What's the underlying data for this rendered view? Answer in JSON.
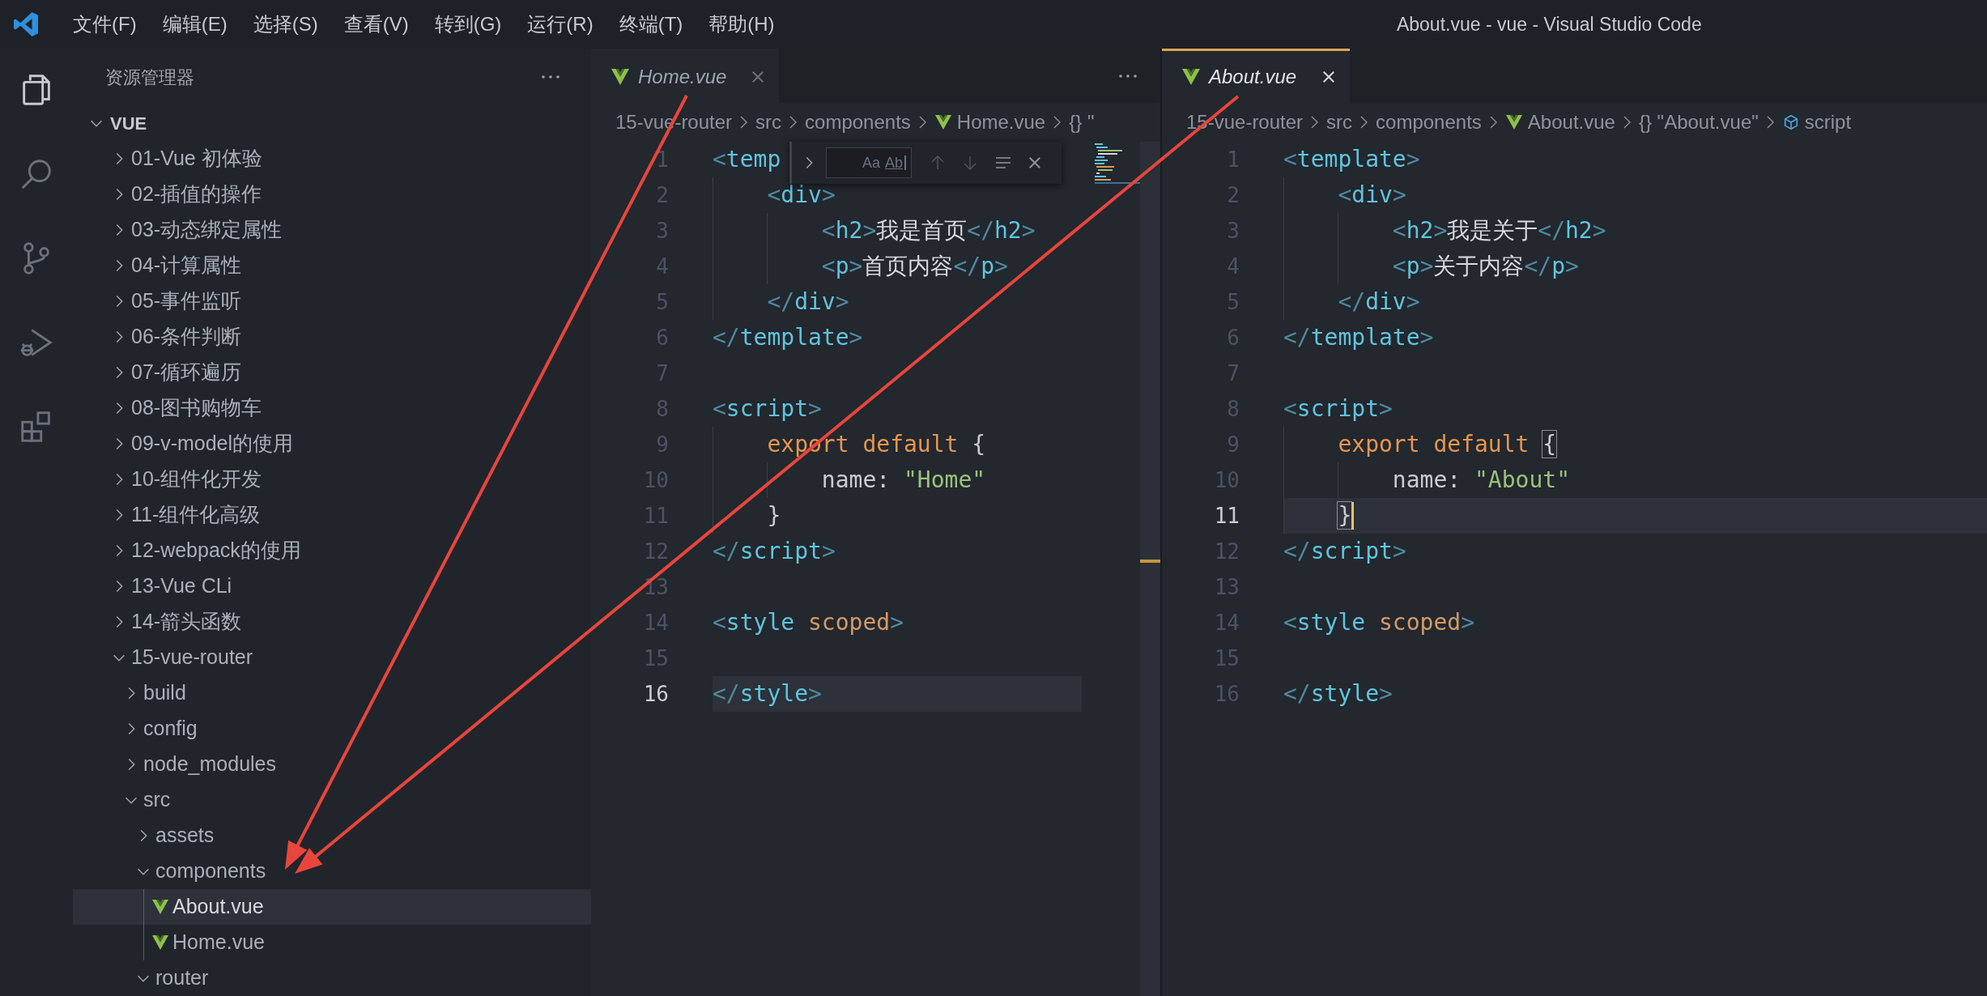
{
  "title_bar": {
    "menus": [
      "文件(F)",
      "编辑(E)",
      "选择(S)",
      "查看(V)",
      "转到(G)",
      "运行(R)",
      "终端(T)",
      "帮助(H)"
    ],
    "title": "About.vue - vue - Visual Studio Code"
  },
  "activity_bar": [
    {
      "kind": "explorer",
      "selected": true
    },
    {
      "kind": "search",
      "selected": false
    },
    {
      "kind": "source-control",
      "selected": false
    },
    {
      "kind": "run-debug",
      "selected": false
    },
    {
      "kind": "extensions",
      "selected": false
    }
  ],
  "explorer": {
    "title": "资源管理器",
    "root": {
      "label": "VUE",
      "expanded": true,
      "children": [
        {
          "kind": "folder",
          "label": "01-Vue 初体验",
          "expanded": false,
          "selected": false
        },
        {
          "kind": "folder",
          "label": "02-插值的操作",
          "expanded": false,
          "selected": false
        },
        {
          "kind": "folder",
          "label": "03-动态绑定属性",
          "expanded": false,
          "selected": false
        },
        {
          "kind": "folder",
          "label": "04-计算属性",
          "expanded": false,
          "selected": false
        },
        {
          "kind": "folder",
          "label": "05-事件监听",
          "expanded": false,
          "selected": false
        },
        {
          "kind": "folder",
          "label": "06-条件判断",
          "expanded": false,
          "selected": false
        },
        {
          "kind": "folder",
          "label": "07-循环遍历",
          "expanded": false,
          "selected": false
        },
        {
          "kind": "folder",
          "label": "08-图书购物车",
          "expanded": false,
          "selected": false
        },
        {
          "kind": "folder",
          "label": "09-v-model的使用",
          "expanded": false,
          "selected": false
        },
        {
          "kind": "folder",
          "label": "10-组件化开发",
          "expanded": false,
          "selected": false
        },
        {
          "kind": "folder",
          "label": "11-组件化高级",
          "expanded": false,
          "selected": false
        },
        {
          "kind": "folder",
          "label": "12-webpack的使用",
          "expanded": false,
          "selected": false
        },
        {
          "kind": "folder",
          "label": "13-Vue CLi",
          "expanded": false,
          "selected": false
        },
        {
          "kind": "folder",
          "label": "14-箭头函数",
          "expanded": false,
          "selected": false
        },
        {
          "kind": "folder",
          "label": "15-vue-router",
          "expanded": true,
          "selected": false,
          "children": [
            {
              "kind": "folder",
              "label": "build",
              "expanded": false,
              "selected": false
            },
            {
              "kind": "folder",
              "label": "config",
              "expanded": false,
              "selected": false
            },
            {
              "kind": "folder",
              "label": "node_modules",
              "expanded": false,
              "selected": false
            },
            {
              "kind": "folder",
              "label": "src",
              "expanded": true,
              "selected": false,
              "children": [
                {
                  "kind": "folder",
                  "label": "assets",
                  "expanded": false,
                  "selected": false
                },
                {
                  "kind": "folder",
                  "label": "components",
                  "expanded": true,
                  "selected": false,
                  "children": [
                    {
                      "kind": "vue-file",
                      "label": "About.vue",
                      "selected": true
                    },
                    {
                      "kind": "vue-file",
                      "label": "Home.vue",
                      "selected": false
                    }
                  ]
                },
                {
                  "kind": "folder",
                  "label": "router",
                  "expanded": true,
                  "selected": false
                }
              ]
            }
          ]
        }
      ]
    }
  },
  "editors": [
    {
      "focused": false,
      "minimap": true,
      "tab": {
        "label": "Home.vue",
        "preview": true
      },
      "breadcrumbs": [
        {
          "kind": "folder",
          "text": "15-vue-router"
        },
        {
          "kind": "folder",
          "text": "src"
        },
        {
          "kind": "folder",
          "text": "components"
        },
        {
          "kind": "vue-file",
          "text": "Home.vue"
        },
        {
          "kind": "object",
          "text": "{} \""
        }
      ],
      "find_widget": {
        "match_case": "Aa",
        "whole_word": "Ab"
      },
      "lines": [
        {
          "number": "1",
          "current": false,
          "tokens": [
            {
              "kind": "bracket",
              "text": "<"
            },
            {
              "kind": "tag",
              "text": "temp"
            }
          ]
        },
        {
          "number": "2",
          "current": false,
          "tokens": [
            {
              "kind": "bracket",
              "text": "    <"
            },
            {
              "kind": "tag",
              "text": "div"
            },
            {
              "kind": "bracket",
              "text": ">"
            }
          ]
        },
        {
          "number": "3",
          "current": false,
          "tokens": [
            {
              "kind": "bracket",
              "text": "        <"
            },
            {
              "kind": "tag",
              "text": "h2"
            },
            {
              "kind": "bracket",
              "text": ">"
            },
            {
              "kind": "text",
              "text": "我是首页"
            },
            {
              "kind": "bracket",
              "text": "</"
            },
            {
              "kind": "tag",
              "text": "h2"
            },
            {
              "kind": "bracket",
              "text": ">"
            }
          ]
        },
        {
          "number": "4",
          "current": false,
          "tokens": [
            {
              "kind": "bracket",
              "text": "        <"
            },
            {
              "kind": "tag",
              "text": "p"
            },
            {
              "kind": "bracket",
              "text": ">"
            },
            {
              "kind": "text",
              "text": "首页内容"
            },
            {
              "kind": "bracket",
              "text": "</"
            },
            {
              "kind": "tag",
              "text": "p"
            },
            {
              "kind": "bracket",
              "text": ">"
            }
          ]
        },
        {
          "number": "5",
          "current": false,
          "tokens": [
            {
              "kind": "bracket",
              "text": "    </"
            },
            {
              "kind": "tag",
              "text": "div"
            },
            {
              "kind": "bracket",
              "text": ">"
            }
          ]
        },
        {
          "number": "6",
          "current": false,
          "tokens": [
            {
              "kind": "bracket",
              "text": "</"
            },
            {
              "kind": "tag",
              "text": "template"
            },
            {
              "kind": "bracket",
              "text": ">"
            }
          ]
        },
        {
          "number": "7",
          "current": false
        },
        {
          "number": "8",
          "current": false,
          "tokens": [
            {
              "kind": "bracket",
              "text": "<"
            },
            {
              "kind": "tag",
              "text": "script"
            },
            {
              "kind": "bracket",
              "text": ">"
            }
          ]
        },
        {
          "number": "9",
          "current": false,
          "tokens": [
            {
              "kind": "keyword",
              "text": "    export default"
            },
            {
              "kind": "brace",
              "text": " {",
              "matched": false
            }
          ]
        },
        {
          "number": "10",
          "current": false,
          "tokens": [
            {
              "kind": "plain",
              "text": "        name: "
            },
            {
              "kind": "string",
              "text": "\"Home\""
            }
          ]
        },
        {
          "number": "11",
          "current": false,
          "tokens": [
            {
              "kind": "brace",
              "text": "    }",
              "matched": false
            }
          ]
        },
        {
          "number": "12",
          "current": false,
          "tokens": [
            {
              "kind": "bracket",
              "text": "</"
            },
            {
              "kind": "tag",
              "text": "script"
            },
            {
              "kind": "bracket",
              "text": ">"
            }
          ]
        },
        {
          "number": "13",
          "current": false
        },
        {
          "number": "14",
          "current": false,
          "tokens": [
            {
              "kind": "bracket",
              "text": "<"
            },
            {
              "kind": "tag",
              "text": "style"
            },
            {
              "kind": "attr",
              "text": " scoped"
            },
            {
              "kind": "bracket",
              "text": ">"
            }
          ]
        },
        {
          "number": "15",
          "current": false
        },
        {
          "number": "16",
          "current": true,
          "tokens": [
            {
              "kind": "bracket",
              "text": "</"
            },
            {
              "kind": "tag",
              "text": "style"
            },
            {
              "kind": "bracket",
              "text": ">"
            }
          ]
        }
      ]
    },
    {
      "focused": true,
      "tab": {
        "label": "About.vue",
        "preview": true
      },
      "breadcrumbs": [
        {
          "kind": "folder",
          "text": "15-vue-router"
        },
        {
          "kind": "folder",
          "text": "src"
        },
        {
          "kind": "folder",
          "text": "components"
        },
        {
          "kind": "vue-file",
          "text": "About.vue"
        },
        {
          "kind": "object",
          "text": "{} \"About.vue\""
        },
        {
          "kind": "element",
          "text": "script"
        }
      ],
      "lines": [
        {
          "number": "1",
          "current": false,
          "tokens": [
            {
              "kind": "bracket",
              "text": "<"
            },
            {
              "kind": "tag",
              "text": "template"
            },
            {
              "kind": "bracket",
              "text": ">"
            }
          ]
        },
        {
          "number": "2",
          "current": false,
          "tokens": [
            {
              "kind": "bracket",
              "text": "    <"
            },
            {
              "kind": "tag",
              "text": "div"
            },
            {
              "kind": "bracket",
              "text": ">"
            }
          ]
        },
        {
          "number": "3",
          "current": false,
          "tokens": [
            {
              "kind": "bracket",
              "text": "        <"
            },
            {
              "kind": "tag",
              "text": "h2"
            },
            {
              "kind": "bracket",
              "text": ">"
            },
            {
              "kind": "text",
              "text": "我是关于"
            },
            {
              "kind": "bracket",
              "text": "</"
            },
            {
              "kind": "tag",
              "text": "h2"
            },
            {
              "kind": "bracket",
              "text": ">"
            }
          ]
        },
        {
          "number": "4",
          "current": false,
          "tokens": [
            {
              "kind": "bracket",
              "text": "        <"
            },
            {
              "kind": "tag",
              "text": "p"
            },
            {
              "kind": "bracket",
              "text": ">"
            },
            {
              "kind": "text",
              "text": "关于内容"
            },
            {
              "kind": "bracket",
              "text": "</"
            },
            {
              "kind": "tag",
              "text": "p"
            },
            {
              "kind": "bracket",
              "text": ">"
            }
          ]
        },
        {
          "number": "5",
          "current": false,
          "tokens": [
            {
              "kind": "bracket",
              "text": "    </"
            },
            {
              "kind": "tag",
              "text": "div"
            },
            {
              "kind": "bracket",
              "text": ">"
            }
          ]
        },
        {
          "number": "6",
          "current": false,
          "tokens": [
            {
              "kind": "bracket",
              "text": "</"
            },
            {
              "kind": "tag",
              "text": "template"
            },
            {
              "kind": "bracket",
              "text": ">"
            }
          ]
        },
        {
          "number": "7",
          "current": false
        },
        {
          "number": "8",
          "current": false,
          "tokens": [
            {
              "kind": "bracket",
              "text": "<"
            },
            {
              "kind": "tag",
              "text": "script"
            },
            {
              "kind": "bracket",
              "text": ">"
            }
          ]
        },
        {
          "number": "9",
          "current": false,
          "tokens": [
            {
              "kind": "keyword",
              "text": "    export default"
            },
            {
              "kind": "brace",
              "text": " {",
              "matched": true
            }
          ]
        },
        {
          "number": "10",
          "current": false,
          "tokens": [
            {
              "kind": "plain",
              "text": "        name: "
            },
            {
              "kind": "string",
              "text": "\"About\""
            }
          ]
        },
        {
          "number": "11",
          "current": true,
          "tokens": [
            {
              "kind": "brace",
              "text": "    }",
              "matched": true
            }
          ]
        },
        {
          "number": "12",
          "current": false,
          "tokens": [
            {
              "kind": "bracket",
              "text": "</"
            },
            {
              "kind": "tag",
              "text": "script"
            },
            {
              "kind": "bracket",
              "text": ">"
            }
          ]
        },
        {
          "number": "13",
          "current": false
        },
        {
          "number": "14",
          "current": false,
          "tokens": [
            {
              "kind": "bracket",
              "text": "<"
            },
            {
              "kind": "tag",
              "text": "style"
            },
            {
              "kind": "attr",
              "text": " scoped"
            },
            {
              "kind": "bracket",
              "text": ">"
            }
          ]
        },
        {
          "number": "15",
          "current": false
        },
        {
          "number": "16",
          "current": false,
          "tokens": [
            {
              "kind": "bracket",
              "text": "</"
            },
            {
              "kind": "tag",
              "text": "style"
            },
            {
              "kind": "bracket",
              "text": ">"
            }
          ]
        }
      ]
    }
  ]
}
